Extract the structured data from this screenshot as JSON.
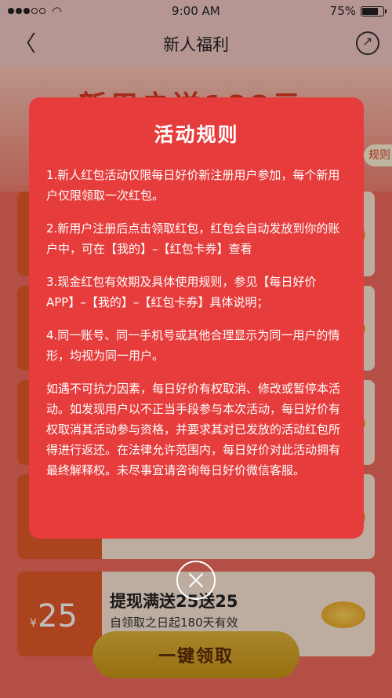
{
  "status_bar": {
    "time": "9:00 AM",
    "battery": "75%",
    "battery_level": 0.75
  },
  "nav": {
    "back_glyph": "〈",
    "title": "新人福利"
  },
  "background": {
    "banner_title": "新用户送188元",
    "rule_tag": "规则",
    "coupon_bottom": {
      "currency": "¥",
      "amount": "25",
      "title": "提现满送25送25",
      "subtitle": "自领取之日起180天有效"
    },
    "claim_button": "一键领取"
  },
  "modal": {
    "title": "活动规则",
    "rules": [
      "1.新人红包活动仅限每日好价新注册用户参加，每个新用户仅限领取一次红包。",
      "2.新用户注册后点击领取红包，红包会自动发放到你的账户中，可在【我的】–【红包卡券】查看",
      "3.现金红包有效期及具体使用规则，参见【每日好价APP】–【我的】–【红包卡券】具体说明；",
      "4.同一账号、同一手机号或其他合理显示为同一用户的情形，均视为同一用户。"
    ],
    "notice": "如遇不可抗力因素，每日好价有权取消、修改或暂停本活动。如发现用户以不正当手段参与本次活动，每日好价有权取消其活动参与资格，并要求其对已发放的活动红包所得进行返还。在法律允许范围内，每日好价对此活动拥有最终解释权。未尽事宜请咨询每日好价微信客服。"
  }
}
